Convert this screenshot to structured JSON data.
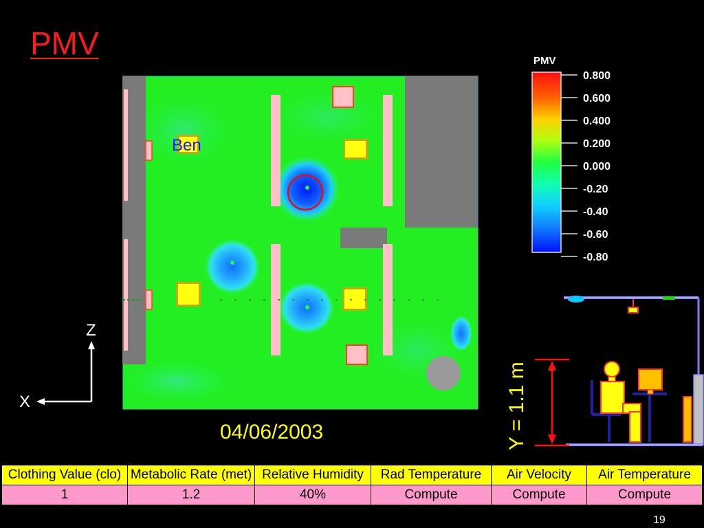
{
  "slide": {
    "title": "PMV",
    "date": "04/06/2003",
    "occupant_label": "Ben",
    "page_number": "19"
  },
  "legend": {
    "title": "PMV",
    "ticks": [
      "0.800",
      "0.600",
      "0.400",
      "0.200",
      "0.000",
      "-0.20",
      "-0.40",
      "-0.60",
      "-0.80"
    ]
  },
  "axes": {
    "vertical_label": "Z",
    "horizontal_label": "X"
  },
  "section_view": {
    "height_label": "Y = 1.1 m"
  },
  "table": {
    "headers": [
      "Clothing Value (clo)",
      "Metabolic Rate (met)",
      "Relative Humidity",
      "Rad Temperature",
      "Air Velocity",
      "Air Temperature"
    ],
    "values": [
      "1",
      "1.2",
      "40%",
      "Compute",
      "Compute",
      "Compute"
    ]
  },
  "colors": {
    "title": "#ff1a1a",
    "date": "#ffff00",
    "header_bg": "#ffff00",
    "value_bg": "#ff99cc",
    "field_green": "#22ee22"
  }
}
